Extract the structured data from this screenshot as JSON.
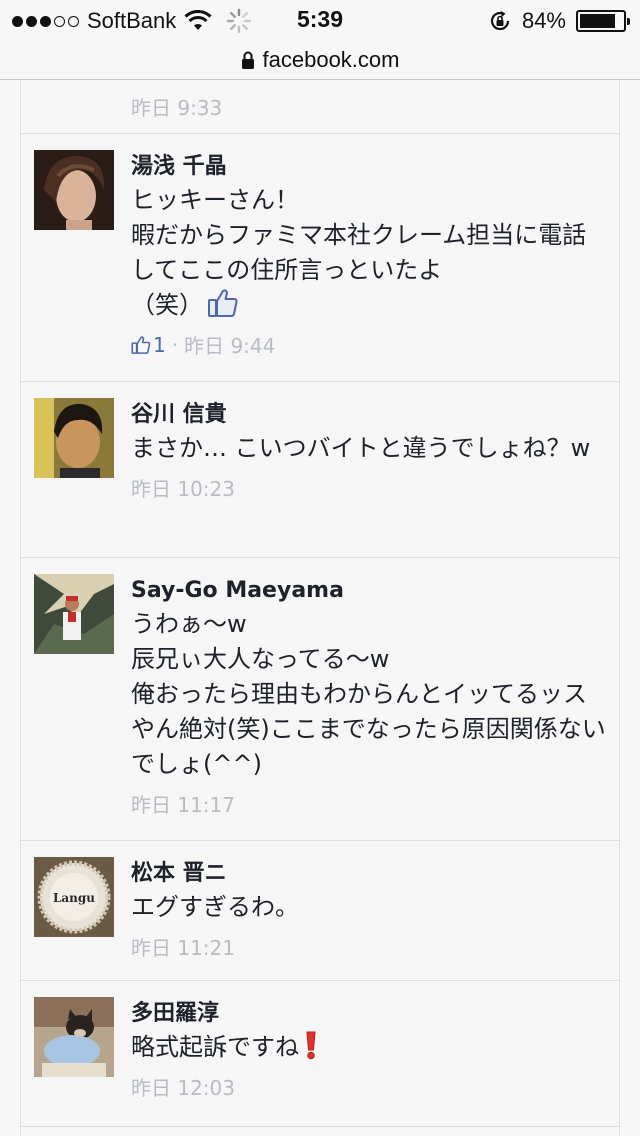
{
  "status_bar": {
    "carrier": "SoftBank",
    "time": "5:39",
    "battery_percent": "84%",
    "battery_level": 0.84,
    "signal_bars_filled": 3
  },
  "url_bar": {
    "domain": "facebook.com"
  },
  "top_partial": {
    "timestamp": "昨日 9:33"
  },
  "comments": [
    {
      "author": "湯浅 千晶",
      "text": "ヒッキーさん！\n暇だからファミマ本社クレーム担当に電話してここの住所言っといたよ\n（笑）",
      "like_count": "1",
      "timestamp": "昨日 9:44"
    },
    {
      "author": "谷川 信貴",
      "text": "まさか… こいつバイトと違うでしょね？w",
      "timestamp": "昨日 10:23"
    },
    {
      "author": "Say-Go Maeyama",
      "text": "うわぁ〜w\n辰兄ぃ大人なってる〜w\n俺おったら理由もわからんとイッてるッスやん絶対(笑)ここまでなったら原因関係ないでしょ(^^)",
      "timestamp": "昨日 11:17"
    },
    {
      "author": "松本 晋ニ",
      "text": "エグすぎるわ。",
      "timestamp": "昨日 11:21",
      "avatar_text": "Langu"
    },
    {
      "author": "多田羅淳",
      "text": "略式起訴ですね",
      "timestamp": "昨日 12:03"
    }
  ],
  "colors": {
    "link_blue": "#4e69a2",
    "meta_grey": "#b8bcc4",
    "text": "#1d2129",
    "exclamation_red": "#e0312f"
  }
}
